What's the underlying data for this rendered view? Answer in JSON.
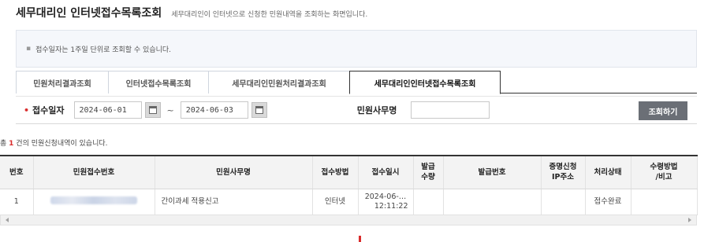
{
  "header": {
    "title": "세무대리인 인터넷접수목록조회",
    "description": "세무대리인이 인터넷으로 신청한 민원내역을 조회하는 화면입니다."
  },
  "notice": {
    "text": "접수일자는 1주일 단위로 조회할 수 있습니다."
  },
  "tabs": [
    {
      "label": "민원처리결과조회"
    },
    {
      "label": "인터넷접수목록조회"
    },
    {
      "label": "세무대리인민원처리결과조회"
    },
    {
      "label": "세무대리인인터넷접수목록조회",
      "active": true
    }
  ],
  "search": {
    "date_label": "접수일자",
    "date_from": "2024-06-01",
    "date_to": "2024-06-03",
    "tilde": "~",
    "name_label": "민원사무명",
    "name_value": "",
    "search_button": "조회하기"
  },
  "summary": {
    "prefix": "총 ",
    "count": "1",
    "suffix": " 건의 민원신청내역이 있습니다."
  },
  "table": {
    "headers": [
      "번호",
      "민원접수번호",
      "민원사무명",
      "접수방법",
      "접수일시",
      "발급\n수량",
      "발급번호",
      "증명신청\nIP주소",
      "처리상태",
      "수령방법\n/비고"
    ],
    "rows": [
      {
        "no": "1",
        "receipt_no": "",
        "service_name": "간이과세 적용신고",
        "method": "인터넷",
        "date": "2024-06-…",
        "time": "12:11:22",
        "qty": "",
        "issue_no": "",
        "ip": "",
        "status": "접수완료",
        "note": ""
      }
    ]
  },
  "colors": {
    "accent_red": "#d92b2b",
    "search_button_bg": "#6b6f76",
    "header_border": "#333333"
  }
}
